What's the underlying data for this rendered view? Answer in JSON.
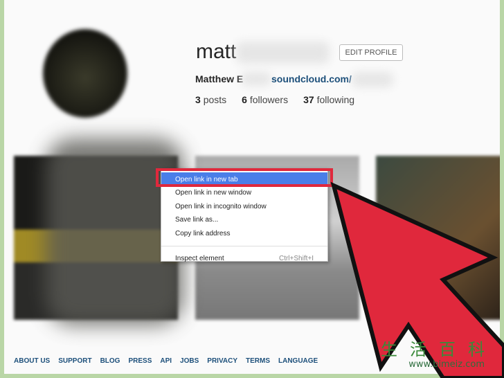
{
  "profile": {
    "username": "matt",
    "edit_label": "EDIT PROFILE",
    "full_name": "Matthew E",
    "website": "soundcloud.com/",
    "stats": {
      "posts_count": "3",
      "posts_label": "posts",
      "followers_count": "6",
      "followers_label": "followers",
      "following_count": "37",
      "following_label": "following"
    }
  },
  "context_menu": {
    "items": [
      {
        "label": "Open link in new tab",
        "highlighted": true
      },
      {
        "label": "Open link in new window"
      },
      {
        "label": "Open link in incognito window"
      },
      {
        "label": "Save link as..."
      },
      {
        "label": "Copy link address"
      }
    ],
    "inspect": {
      "label": "Inspect element",
      "shortcut": "Ctrl+Shift+I"
    }
  },
  "footer": {
    "links": [
      "ABOUT US",
      "SUPPORT",
      "BLOG",
      "PRESS",
      "API",
      "JOBS",
      "PRIVACY",
      "TERMS",
      "LANGUAGE"
    ]
  },
  "watermark": {
    "chinese": "生活百科",
    "url": "www.bimeiz.com"
  },
  "colors": {
    "highlight_box": "#e0283c",
    "menu_selected": "#4a7ee8",
    "link": "#1c4f7a"
  }
}
